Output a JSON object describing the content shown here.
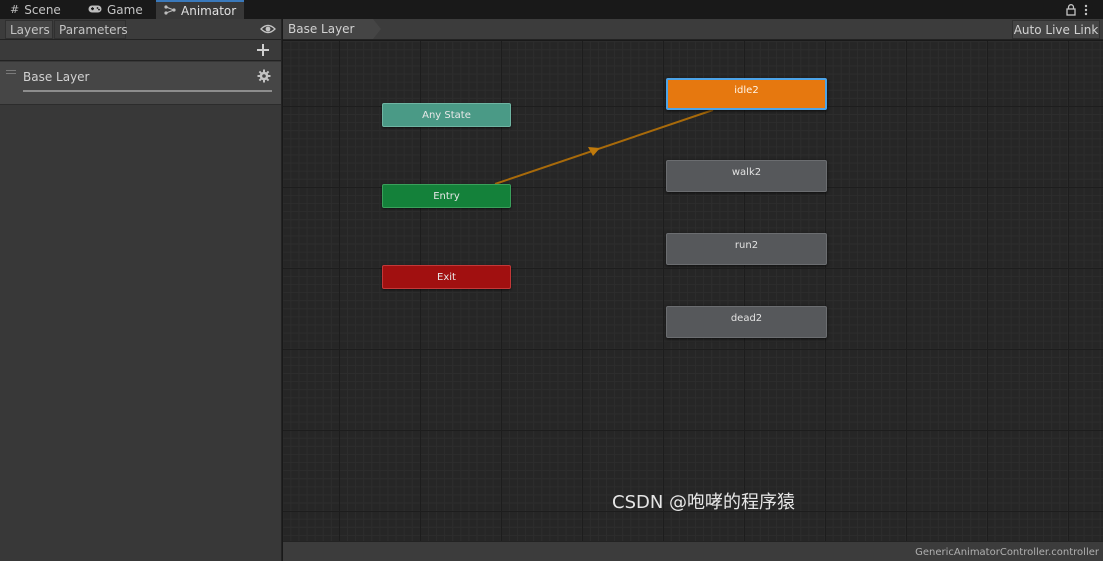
{
  "tabs": [
    {
      "label": "Scene",
      "icon": "grid-icon"
    },
    {
      "label": "Game",
      "icon": "gamepad-icon"
    },
    {
      "label": "Animator",
      "icon": "animator-icon",
      "active": true
    }
  ],
  "left_panel": {
    "tabs": [
      "Layers",
      "Parameters"
    ],
    "layer_name": "Base Layer"
  },
  "graph": {
    "breadcrumb": "Base Layer",
    "auto_live_link": "Auto Live Link",
    "nodes": {
      "any_state": "Any State",
      "entry": "Entry",
      "exit": "Exit"
    },
    "states": [
      "idle2",
      "walk2",
      "run2",
      "dead2"
    ],
    "default_state": "idle2",
    "asset_path": "GenericAnimatorController.controller"
  },
  "watermark": "CSDN @咆哮的程序猿",
  "colors": {
    "default_state": "#e6780f",
    "selected_outline": "#4da4e8",
    "any_state": "#4a9a86",
    "entry": "#14813a",
    "exit": "#a11010",
    "state": "#56585b",
    "transition": "#a86a0a",
    "active_tab_accent": "#3a79bb"
  }
}
